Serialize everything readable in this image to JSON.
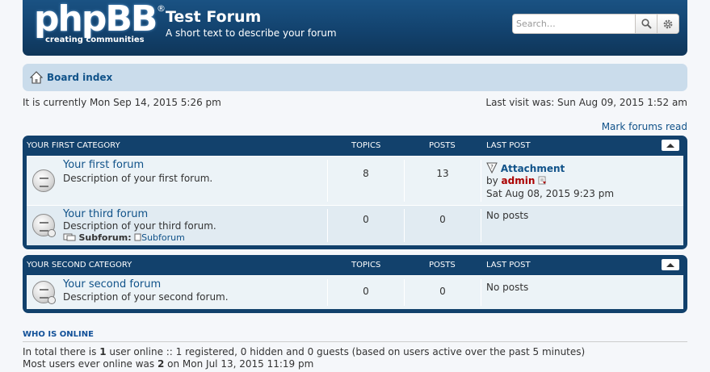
{
  "header": {
    "logo_text": "phpBB",
    "logo_reg": "®",
    "logo_sub": "creating communities",
    "site_title": "Test Forum",
    "site_desc": "A short text to describe your forum",
    "search_placeholder": "Search…"
  },
  "navbar": {
    "board_index": "Board index"
  },
  "info": {
    "current_time": "It is currently Mon Sep 14, 2015 5:26 pm",
    "last_visit": "Last visit was: Sun Aug 09, 2015 1:52 am",
    "mark_read": "Mark forums read"
  },
  "columns": {
    "topics": "TOPICS",
    "posts": "POSTS",
    "last_post": "LAST POST"
  },
  "categories": [
    {
      "name": "YOUR FIRST CATEGORY",
      "forums": [
        {
          "title": "Your first forum",
          "desc": "Description of your first forum.",
          "topics": "8",
          "posts": "13",
          "last_topic": "Attachment",
          "by": "by",
          "last_user": "admin",
          "last_date": "Sat Aug 08, 2015 9:23 pm"
        },
        {
          "title": "Your third forum",
          "desc": "Description of your third forum.",
          "subforum_label": "Subforum:",
          "subforum": "Subforum",
          "topics": "0",
          "posts": "0",
          "no_posts": "No posts"
        }
      ]
    },
    {
      "name": "YOUR SECOND CATEGORY",
      "forums": [
        {
          "title": "Your second forum",
          "desc": "Description of your second forum.",
          "topics": "0",
          "posts": "0",
          "no_posts": "No posts"
        }
      ]
    }
  ],
  "online": {
    "title": "WHO IS ONLINE",
    "line1_pre": "In total there is ",
    "line1_count": "1",
    "line1_post": " user online :: 1 registered, 0 hidden and 0 guests (based on users active over the past 5 minutes)",
    "line2_pre": "Most users ever online was ",
    "line2_count": "2",
    "line2_post": " on Mon Jul 13, 2015 11:19 pm"
  }
}
